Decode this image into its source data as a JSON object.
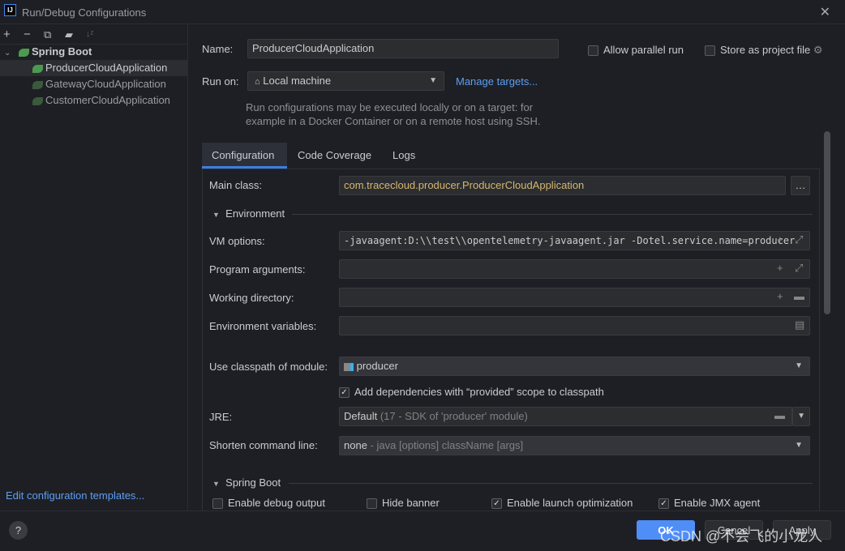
{
  "window": {
    "title": "Run/Debug Configurations",
    "logo": "IJ"
  },
  "sidebar": {
    "group": "Spring Boot",
    "items": [
      {
        "label": "ProducerCloudApplication",
        "selected": true
      },
      {
        "label": "GatewayCloudApplication"
      },
      {
        "label": "CustomerCloudApplication"
      }
    ],
    "edit_templates": "Edit configuration templates..."
  },
  "form": {
    "name_label": "Name:",
    "name_value": "ProducerCloudApplication",
    "allow_parallel": "Allow parallel run",
    "store_project": "Store as project file",
    "run_on_label": "Run on:",
    "run_on_value": "Local machine",
    "manage_targets": "Manage targets...",
    "hint1": "Run configurations may be executed locally or on a target: for",
    "hint2": "example in a Docker Container or on a remote host using SSH.",
    "tabs": [
      "Configuration",
      "Code Coverage",
      "Logs"
    ],
    "main_class_label": "Main class:",
    "main_class_value": "com.tracecloud.producer.ProducerCloudApplication",
    "environment": "Environment",
    "vm_label": "VM options:",
    "vm_value": "-javaagent:D:\\\\test\\\\opentelemetry-javaagent.jar -Dotel.service.name=producer",
    "program_args_label": "Program arguments:",
    "working_dir_label": "Working directory:",
    "env_vars_label": "Environment variables:",
    "classpath_label": "Use classpath of module:",
    "classpath_value": "producer",
    "add_deps": "Add dependencies with “provided” scope to classpath",
    "jre_label": "JRE:",
    "jre_value": "Default",
    "jre_hint": "(17 - SDK of 'producer' module)",
    "shorten_label": "Shorten command line:",
    "shorten_value": "none",
    "shorten_hint": "- java [options] className [args]",
    "spring_boot": "Spring Boot",
    "debug_output": "Enable debug output",
    "hide_banner": "Hide banner",
    "launch_opt": "Enable launch optimization",
    "jmx": "Enable JMX agent"
  },
  "buttons": {
    "ok": "OK",
    "cancel": "Cancel",
    "apply": "Apply",
    "help": "?"
  },
  "watermark": "CSDN @不会飞的小龙人",
  "colors": {
    "accent": "#3d7fe0",
    "link": "#5c9ff2",
    "main_class": "#d6b66f",
    "ok": "#4f8ef7"
  }
}
